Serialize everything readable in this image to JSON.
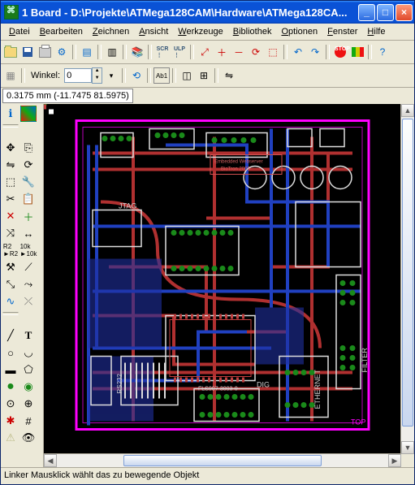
{
  "title": "1 Board - D:\\Projekte\\ATMega128CAM\\Hardware\\ATMega128CA... ",
  "menus": [
    "Datei",
    "Bearbeiten",
    "Zeichnen",
    "Ansicht",
    "Werkzeuge",
    "Bibliothek",
    "Optionen",
    "Fenster",
    "Hilfe"
  ],
  "angle_label": "Winkel:",
  "angle_value": "0",
  "coord_readout": "0.3175 mm (-11.7475 81.5975)",
  "status_text": "Linker Mausklick wählt das zu bewegende Objekt",
  "toolbar1_icons": [
    "open",
    "save",
    "print",
    "cam",
    "sep",
    "board-switch",
    "sep",
    "sheet",
    "sep",
    "book",
    "sep",
    "script",
    "ulp",
    "sep",
    "zoom-fit",
    "zoom-in",
    "zoom-out",
    "zoom-redraw",
    "zoom-select",
    "sep",
    "undo",
    "redo",
    "sep",
    "stop",
    "go",
    "sep",
    "help"
  ],
  "toolbar2_icons": [
    "grid",
    "sep",
    "angle",
    "sep",
    "alt",
    "sep",
    "ab1",
    "sep",
    "layout1",
    "layout2",
    "sep",
    "mirror"
  ],
  "palette_icons": [
    "info",
    "layers",
    "sep",
    "move",
    "copy",
    "mirror",
    "rotate",
    "group",
    "change",
    "cut",
    "paste",
    "delete",
    "add",
    "pinswap",
    "replace",
    "lock",
    "tag",
    "name",
    "value",
    "smash",
    "miter",
    "split",
    "optimize",
    "route",
    "ripup",
    "wire",
    "text",
    "circle",
    "arc",
    "rect",
    "poly",
    "via",
    "signal",
    "hole",
    "attrib",
    "ratsnest",
    "auto",
    "erc",
    "errors",
    "mark",
    "dim"
  ],
  "pcb_labels": {
    "jtag": "JTAG",
    "dig": "DIG",
    "fls": "FLS007-3003-0",
    "ethernet": "ETHERNET",
    "filter": "FILTER",
    "rs232": "RS232",
    "top": "TOP",
    "brand1": "Embedded Webserver",
    "brand2": "BioTron 2005"
  }
}
